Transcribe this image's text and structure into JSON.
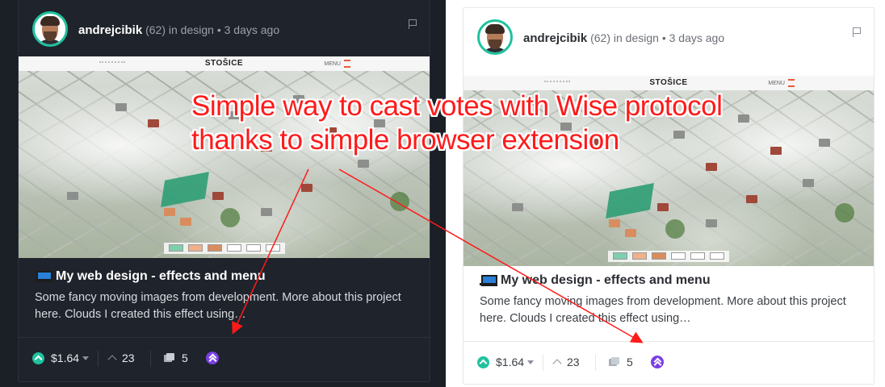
{
  "posts": [
    {
      "theme": "dark",
      "author": "andrejcibik",
      "reputation": "(62)",
      "meta_suffix": " in design • 3 days ago",
      "image_site_logo": "STOŠICE",
      "image_menu_label": "MENU",
      "title": "My web design - effects and menu",
      "summary": "Some fancy moving images from development. More about this project here.   Clouds I created this effect using…",
      "payout": "$1.64",
      "votes": "23",
      "comments": "5"
    },
    {
      "theme": "light",
      "author": "andrejcibik",
      "reputation": "(62)",
      "meta_suffix": " in design • 3 days ago",
      "image_site_logo": "STOŠICE",
      "image_menu_label": "MENU",
      "title": "My web design - effects and menu",
      "summary": "Some fancy moving images from development. More about this project here.   Clouds I created this effect using…",
      "payout": "$1.64",
      "votes": "23",
      "comments": "5"
    }
  ],
  "annotation": {
    "line1": "Simple way to cast votes with Wise protocol",
    "line2": "thanks to simple browser extension",
    "color": "#ff1a1a"
  },
  "colors": {
    "accent_green": "#1fc29e",
    "wise_purple": "#7b3fe4",
    "dark_bg": "#1b1f26"
  }
}
